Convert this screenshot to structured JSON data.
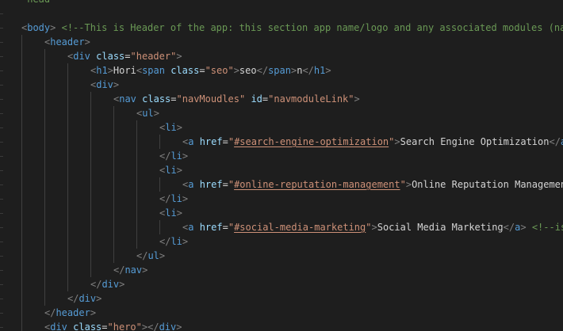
{
  "editor": {
    "language": "html",
    "theme_colors": {
      "background": "#1e1e1e",
      "punctuation": "#808080",
      "tag": "#569cd6",
      "attribute": "#9cdcfe",
      "string": "#ce9178",
      "comment": "#6a9955",
      "text": "#d4d4d4"
    },
    "lines": [
      {
        "indent": 0,
        "tokens": [
          {
            "t": "c",
            "v": "-head"
          }
        ]
      },
      {
        "indent": 0,
        "tokens": [
          {
            "t": "x",
            "v": ""
          }
        ]
      },
      {
        "indent": 0,
        "tokens": [
          {
            "t": "p",
            "v": "<"
          },
          {
            "t": "t",
            "v": "body"
          },
          {
            "t": "p",
            "v": ">"
          },
          {
            "t": "x",
            "v": " "
          },
          {
            "t": "c",
            "v": "<!--This is Header of the app: this section app name/logo and any associated modules (na"
          }
        ]
      },
      {
        "indent": 1,
        "tokens": [
          {
            "t": "p",
            "v": "<"
          },
          {
            "t": "t",
            "v": "header"
          },
          {
            "t": "p",
            "v": ">"
          }
        ]
      },
      {
        "indent": 2,
        "tokens": [
          {
            "t": "p",
            "v": "<"
          },
          {
            "t": "t",
            "v": "div"
          },
          {
            "t": "x",
            "v": " "
          },
          {
            "t": "a",
            "v": "class"
          },
          {
            "t": "x",
            "v": "="
          },
          {
            "t": "s",
            "v": "\"header\""
          },
          {
            "t": "p",
            "v": ">"
          }
        ]
      },
      {
        "indent": 3,
        "tokens": [
          {
            "t": "p",
            "v": "<"
          },
          {
            "t": "t",
            "v": "h1"
          },
          {
            "t": "p",
            "v": ">"
          },
          {
            "t": "x",
            "v": "Hori"
          },
          {
            "t": "p",
            "v": "<"
          },
          {
            "t": "t",
            "v": "span"
          },
          {
            "t": "x",
            "v": " "
          },
          {
            "t": "a",
            "v": "class"
          },
          {
            "t": "x",
            "v": "="
          },
          {
            "t": "s",
            "v": "\"seo\""
          },
          {
            "t": "p",
            "v": ">"
          },
          {
            "t": "x",
            "v": "seo"
          },
          {
            "t": "p",
            "v": "</"
          },
          {
            "t": "t",
            "v": "span"
          },
          {
            "t": "p",
            "v": ">"
          },
          {
            "t": "x",
            "v": "n"
          },
          {
            "t": "p",
            "v": "</"
          },
          {
            "t": "t",
            "v": "h1"
          },
          {
            "t": "p",
            "v": ">"
          }
        ]
      },
      {
        "indent": 3,
        "tokens": [
          {
            "t": "p",
            "v": "<"
          },
          {
            "t": "t",
            "v": "div"
          },
          {
            "t": "p",
            "v": ">"
          }
        ]
      },
      {
        "indent": 4,
        "tokens": [
          {
            "t": "p",
            "v": "<"
          },
          {
            "t": "t",
            "v": "nav"
          },
          {
            "t": "x",
            "v": " "
          },
          {
            "t": "a",
            "v": "class"
          },
          {
            "t": "x",
            "v": "="
          },
          {
            "t": "s",
            "v": "\"navMoudles\""
          },
          {
            "t": "x",
            "v": " "
          },
          {
            "t": "a",
            "v": "id"
          },
          {
            "t": "x",
            "v": "="
          },
          {
            "t": "s",
            "v": "\"navmoduleLink\""
          },
          {
            "t": "p",
            "v": ">"
          }
        ]
      },
      {
        "indent": 5,
        "tokens": [
          {
            "t": "p",
            "v": "<"
          },
          {
            "t": "t",
            "v": "ul"
          },
          {
            "t": "p",
            "v": ">"
          }
        ]
      },
      {
        "indent": 6,
        "tokens": [
          {
            "t": "p",
            "v": "<"
          },
          {
            "t": "t",
            "v": "li"
          },
          {
            "t": "p",
            "v": ">"
          }
        ]
      },
      {
        "indent": 7,
        "tokens": [
          {
            "t": "p",
            "v": "<"
          },
          {
            "t": "t",
            "v": "a"
          },
          {
            "t": "x",
            "v": " "
          },
          {
            "t": "a",
            "v": "href"
          },
          {
            "t": "x",
            "v": "="
          },
          {
            "t": "s",
            "v": "\""
          },
          {
            "t": "su",
            "v": "#search-engine-optimization"
          },
          {
            "t": "s",
            "v": "\""
          },
          {
            "t": "p",
            "v": ">"
          },
          {
            "t": "x",
            "v": "Search Engine Optimization"
          },
          {
            "t": "p",
            "v": "</"
          },
          {
            "t": "t",
            "v": "a"
          }
        ]
      },
      {
        "indent": 6,
        "tokens": [
          {
            "t": "p",
            "v": "</"
          },
          {
            "t": "t",
            "v": "li"
          },
          {
            "t": "p",
            "v": ">"
          }
        ]
      },
      {
        "indent": 6,
        "tokens": [
          {
            "t": "p",
            "v": "<"
          },
          {
            "t": "t",
            "v": "li"
          },
          {
            "t": "p",
            "v": ">"
          }
        ]
      },
      {
        "indent": 7,
        "tokens": [
          {
            "t": "p",
            "v": "<"
          },
          {
            "t": "t",
            "v": "a"
          },
          {
            "t": "x",
            "v": " "
          },
          {
            "t": "a",
            "v": "href"
          },
          {
            "t": "x",
            "v": "="
          },
          {
            "t": "s",
            "v": "\""
          },
          {
            "t": "su",
            "v": "#online-reputation-management"
          },
          {
            "t": "s",
            "v": "\""
          },
          {
            "t": "p",
            "v": ">"
          },
          {
            "t": "x",
            "v": "Online Reputation Managemen"
          }
        ]
      },
      {
        "indent": 6,
        "tokens": [
          {
            "t": "p",
            "v": "</"
          },
          {
            "t": "t",
            "v": "li"
          },
          {
            "t": "p",
            "v": ">"
          }
        ]
      },
      {
        "indent": 6,
        "tokens": [
          {
            "t": "p",
            "v": "<"
          },
          {
            "t": "t",
            "v": "li"
          },
          {
            "t": "p",
            "v": ">"
          }
        ]
      },
      {
        "indent": 7,
        "tokens": [
          {
            "t": "p",
            "v": "<"
          },
          {
            "t": "t",
            "v": "a"
          },
          {
            "t": "x",
            "v": " "
          },
          {
            "t": "a",
            "v": "href"
          },
          {
            "t": "x",
            "v": "="
          },
          {
            "t": "s",
            "v": "\""
          },
          {
            "t": "su",
            "v": "#social-media-marketing"
          },
          {
            "t": "s",
            "v": "\""
          },
          {
            "t": "p",
            "v": ">"
          },
          {
            "t": "x",
            "v": "Social Media Marketing"
          },
          {
            "t": "p",
            "v": "</"
          },
          {
            "t": "t",
            "v": "a"
          },
          {
            "t": "p",
            "v": ">"
          },
          {
            "t": "x",
            "v": " "
          },
          {
            "t": "c",
            "v": "<!--is"
          }
        ]
      },
      {
        "indent": 6,
        "tokens": [
          {
            "t": "p",
            "v": "</"
          },
          {
            "t": "t",
            "v": "li"
          },
          {
            "t": "p",
            "v": ">"
          }
        ]
      },
      {
        "indent": 5,
        "tokens": [
          {
            "t": "p",
            "v": "</"
          },
          {
            "t": "t",
            "v": "ul"
          },
          {
            "t": "p",
            "v": ">"
          }
        ]
      },
      {
        "indent": 4,
        "tokens": [
          {
            "t": "p",
            "v": "</"
          },
          {
            "t": "t",
            "v": "nav"
          },
          {
            "t": "p",
            "v": ">"
          }
        ]
      },
      {
        "indent": 3,
        "tokens": [
          {
            "t": "p",
            "v": "</"
          },
          {
            "t": "t",
            "v": "div"
          },
          {
            "t": "p",
            "v": ">"
          }
        ]
      },
      {
        "indent": 2,
        "tokens": [
          {
            "t": "p",
            "v": "</"
          },
          {
            "t": "t",
            "v": "div"
          },
          {
            "t": "p",
            "v": ">"
          }
        ]
      },
      {
        "indent": 1,
        "tokens": [
          {
            "t": "p",
            "v": "</"
          },
          {
            "t": "t",
            "v": "header"
          },
          {
            "t": "p",
            "v": ">"
          }
        ]
      },
      {
        "indent": 1,
        "tokens": [
          {
            "t": "p",
            "v": "<"
          },
          {
            "t": "t",
            "v": "div"
          },
          {
            "t": "x",
            "v": " "
          },
          {
            "t": "a",
            "v": "class"
          },
          {
            "t": "x",
            "v": "="
          },
          {
            "t": "s",
            "v": "\"hero\""
          },
          {
            "t": "p",
            "v": ">"
          },
          {
            "t": "p",
            "v": "</"
          },
          {
            "t": "t",
            "v": "div"
          },
          {
            "t": "p",
            "v": ">"
          }
        ]
      }
    ]
  }
}
